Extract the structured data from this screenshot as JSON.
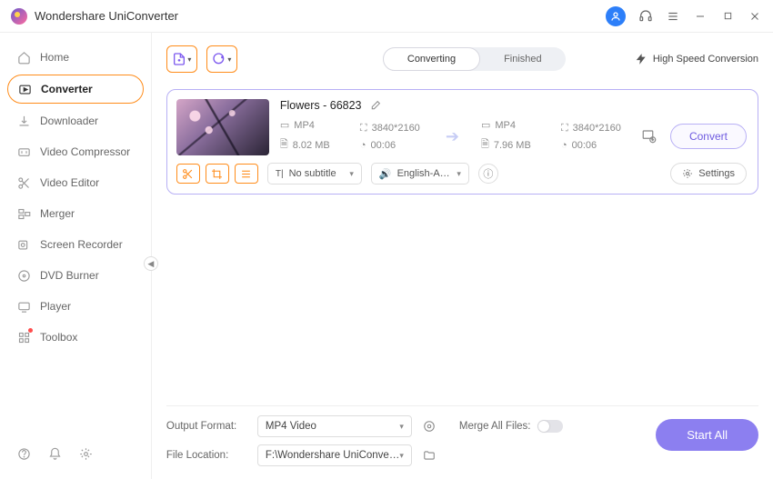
{
  "app": {
    "title": "Wondershare UniConverter"
  },
  "sidebar": {
    "items": [
      {
        "label": "Home"
      },
      {
        "label": "Converter"
      },
      {
        "label": "Downloader"
      },
      {
        "label": "Video Compressor"
      },
      {
        "label": "Video Editor"
      },
      {
        "label": "Merger"
      },
      {
        "label": "Screen Recorder"
      },
      {
        "label": "DVD Burner"
      },
      {
        "label": "Player"
      },
      {
        "label": "Toolbox"
      }
    ]
  },
  "tabs": {
    "converting": "Converting",
    "finished": "Finished"
  },
  "toolbar": {
    "highspeed": "High Speed Conversion"
  },
  "file": {
    "title": "Flowers - 66823",
    "src": {
      "format": "MP4",
      "resolution": "3840*2160",
      "size": "8.02 MB",
      "duration": "00:06"
    },
    "dst": {
      "format": "MP4",
      "resolution": "3840*2160",
      "size": "7.96 MB",
      "duration": "00:06"
    },
    "subtitle": "No subtitle",
    "audio": "English-Advan...",
    "settings": "Settings",
    "convert": "Convert"
  },
  "bottom": {
    "format_label": "Output Format:",
    "format_value": "MP4 Video",
    "location_label": "File Location:",
    "location_value": "F:\\Wondershare UniConverter",
    "merge_label": "Merge All Files:",
    "start_all": "Start All"
  }
}
